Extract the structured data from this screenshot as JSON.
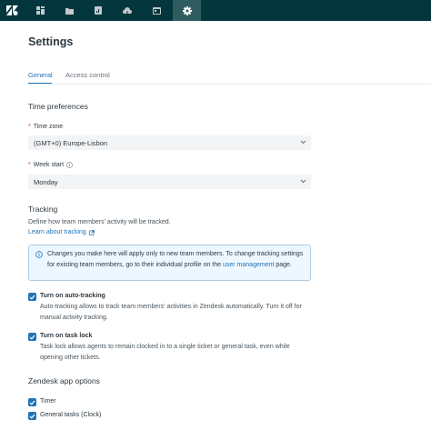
{
  "nav": {
    "items": [
      {
        "name": "dashboard-icon"
      },
      {
        "name": "folder-icon"
      },
      {
        "name": "reports-icon"
      },
      {
        "name": "cloud-icon"
      },
      {
        "name": "calendar-icon"
      },
      {
        "name": "settings-icon",
        "active": true
      }
    ]
  },
  "page": {
    "title": "Settings"
  },
  "tabs": [
    {
      "label": "General",
      "active": true
    },
    {
      "label": "Access control",
      "active": false
    }
  ],
  "time_preferences": {
    "title": "Time preferences",
    "required_marker": "*",
    "timezone_label": "Time zone",
    "timezone_value": "(GMT+0) Europe-Lisbon",
    "week_start_label": "Week start",
    "week_start_value": "Monday"
  },
  "tracking": {
    "title": "Tracking",
    "description": "Define how team members' activity will be tracked.",
    "learn_link": "Learn about tracking",
    "notice_text": "Changes you make here will apply only to new team members. To change tracking settings for existing team members, go to their individual profile on the",
    "notice_link": "user management",
    "notice_suffix": " page.",
    "auto_tracking_label": "Turn on auto-tracking",
    "auto_tracking_desc": "Auto-tracking allows to track team members' activities in Zendesk automatically. Turn it off for manual activity tracking.",
    "task_lock_label": "Turn on task lock",
    "task_lock_desc": "Task lock allows agents to remain clocked in to a single ticket or general task, even while opening other tickets."
  },
  "app_options": {
    "title": "Zendesk app options",
    "timer_label": "Timer",
    "general_tasks_label": "General tasks (Clock)"
  },
  "colors": {
    "topbar": "#03363d",
    "active_nav": "#2f5c61",
    "accent": "#1f73b7",
    "required": "#cc3340",
    "notice_bg": "#edf7ff"
  }
}
